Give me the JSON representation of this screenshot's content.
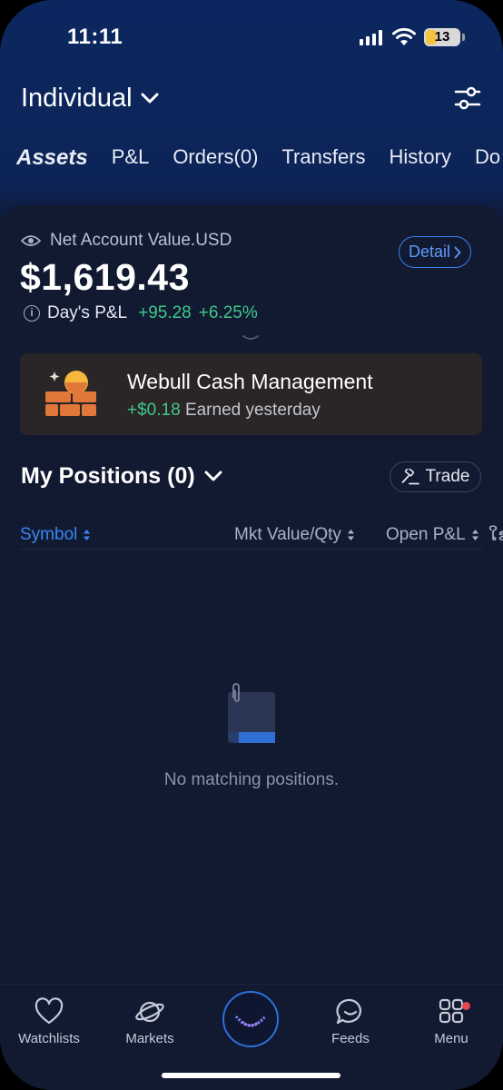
{
  "status_bar": {
    "time": "11:11",
    "battery": "13"
  },
  "header": {
    "account": "Individual"
  },
  "tabs": [
    "Assets",
    "P&L",
    "Orders(0)",
    "Transfers",
    "History",
    "Do"
  ],
  "summary": {
    "net_label": "Net Account Value.USD",
    "detail_label": "Detail",
    "value": "$1,619.43",
    "pnl_label": "Day's P&L",
    "pnl_value": "+95.28",
    "pnl_percent": "+6.25%"
  },
  "cash_card": {
    "title": "Webull Cash Management",
    "gain": "+$0.18",
    "sub": "Earned yesterday"
  },
  "positions": {
    "title": "My Positions (0)",
    "trade_label": "Trade",
    "columns": [
      "Symbol",
      "Mkt Value/Qty",
      "Open P&L",
      "ໃຂ"
    ],
    "empty_text": "No matching positions."
  },
  "bottom_nav": [
    "Watchlists",
    "Markets",
    "Feeds",
    "Menu"
  ],
  "colors": {
    "accent": "#3b87f3",
    "gain": "#3ec98a",
    "header_bg": "#0c2760",
    "panel_bg": "#121a32",
    "cash_orange": "#e2773a"
  },
  "icons": [
    "signal-icon",
    "wifi-icon",
    "battery-icon",
    "chevron-down-icon",
    "sliders-icon",
    "eye-icon",
    "info-icon",
    "chevron-right-icon",
    "cash-bricks-icon",
    "gavel-icon",
    "sort-icon",
    "document-icon",
    "heart-icon",
    "planet-icon",
    "webull-logo-icon",
    "chat-smile-icon",
    "grid-icon"
  ]
}
